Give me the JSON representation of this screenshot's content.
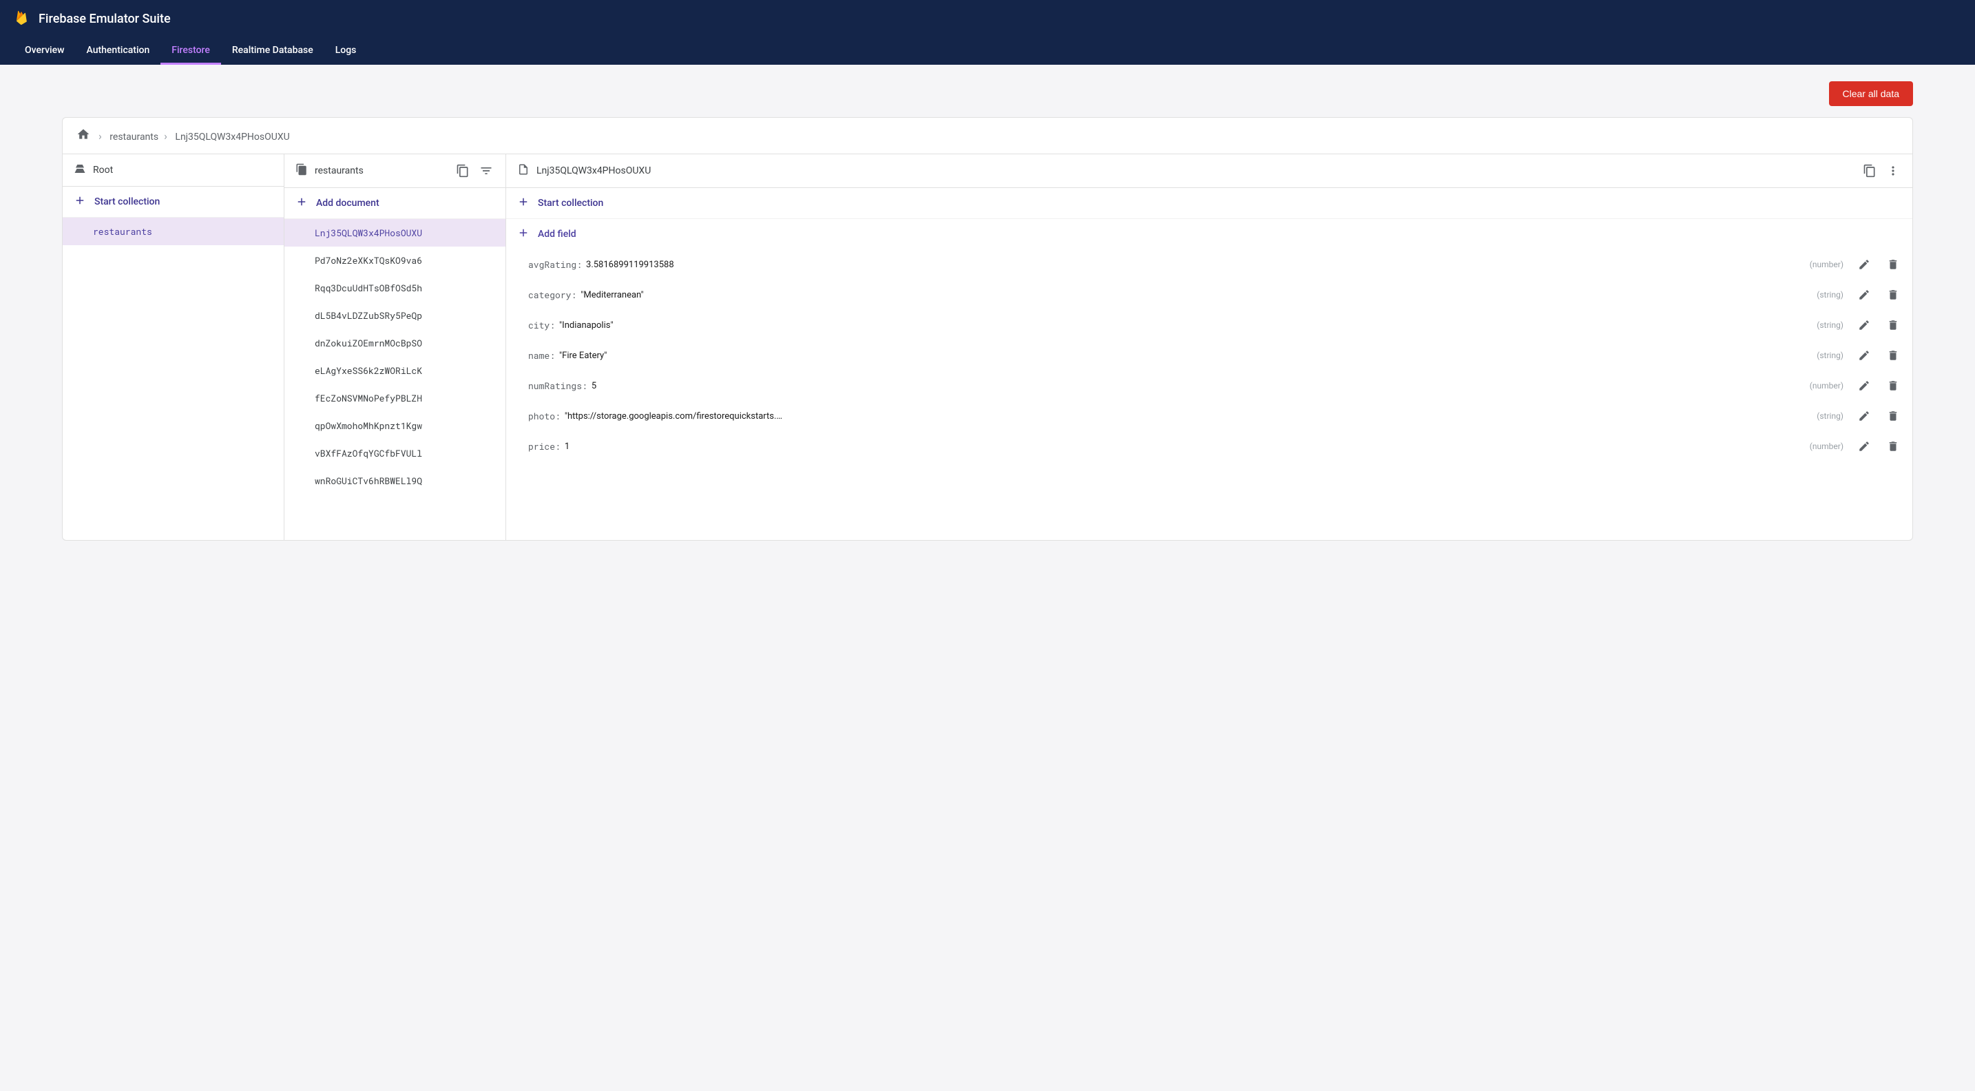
{
  "header": {
    "title": "Firebase Emulator Suite",
    "tabs": [
      {
        "label": "Overview",
        "active": false
      },
      {
        "label": "Authentication",
        "active": false
      },
      {
        "label": "Firestore",
        "active": true
      },
      {
        "label": "Realtime Database",
        "active": false
      },
      {
        "label": "Logs",
        "active": false
      }
    ]
  },
  "toolbar": {
    "clear_label": "Clear all data"
  },
  "breadcrumbs": {
    "items": [
      {
        "label": "restaurants"
      },
      {
        "label": "Lnj35QLQW3x4PHosOUXU"
      }
    ]
  },
  "columns": {
    "root": {
      "header_label": "Root",
      "add_label": "Start collection",
      "items": [
        {
          "label": "restaurants",
          "selected": true
        }
      ]
    },
    "collection": {
      "header_label": "restaurants",
      "add_label": "Add document",
      "items": [
        {
          "label": "Lnj35QLQW3x4PHosOUXU",
          "selected": true
        },
        {
          "label": "Pd7oNz2eXKxTQsKO9va6",
          "selected": false
        },
        {
          "label": "Rqq3DcuUdHTsOBfOSd5h",
          "selected": false
        },
        {
          "label": "dL5B4vLDZZubSRy5PeQp",
          "selected": false
        },
        {
          "label": "dnZokuiZOEmrnMOcBpSO",
          "selected": false
        },
        {
          "label": "eLAgYxeSS6k2zWORiLcK",
          "selected": false
        },
        {
          "label": "fEcZoNSVMNoPefyPBLZH",
          "selected": false
        },
        {
          "label": "qpOwXmohoMhKpnzt1Kgw",
          "selected": false
        },
        {
          "label": "vBXfFAzOfqYGCfbFVULl",
          "selected": false
        },
        {
          "label": "wnRoGUiCTv6hRBWELl9Q",
          "selected": false
        }
      ]
    },
    "document": {
      "header_label": "Lnj35QLQW3x4PHosOUXU",
      "start_collection_label": "Start collection",
      "add_field_label": "Add field",
      "fields": [
        {
          "key": "avgRating",
          "value": "3.5816899119913588",
          "type": "number",
          "is_string": false
        },
        {
          "key": "category",
          "value": "\"Mediterranean\"",
          "type": "string",
          "is_string": true
        },
        {
          "key": "city",
          "value": "\"Indianapolis\"",
          "type": "string",
          "is_string": true
        },
        {
          "key": "name",
          "value": "\"Fire Eatery\"",
          "type": "string",
          "is_string": true
        },
        {
          "key": "numRatings",
          "value": "5",
          "type": "number",
          "is_string": false
        },
        {
          "key": "photo",
          "value": "\"https://storage.googleapis.com/firestorequickstarts.appspot.…",
          "type": "string",
          "is_string": true
        },
        {
          "key": "price",
          "value": "1",
          "type": "number",
          "is_string": false
        }
      ]
    }
  }
}
